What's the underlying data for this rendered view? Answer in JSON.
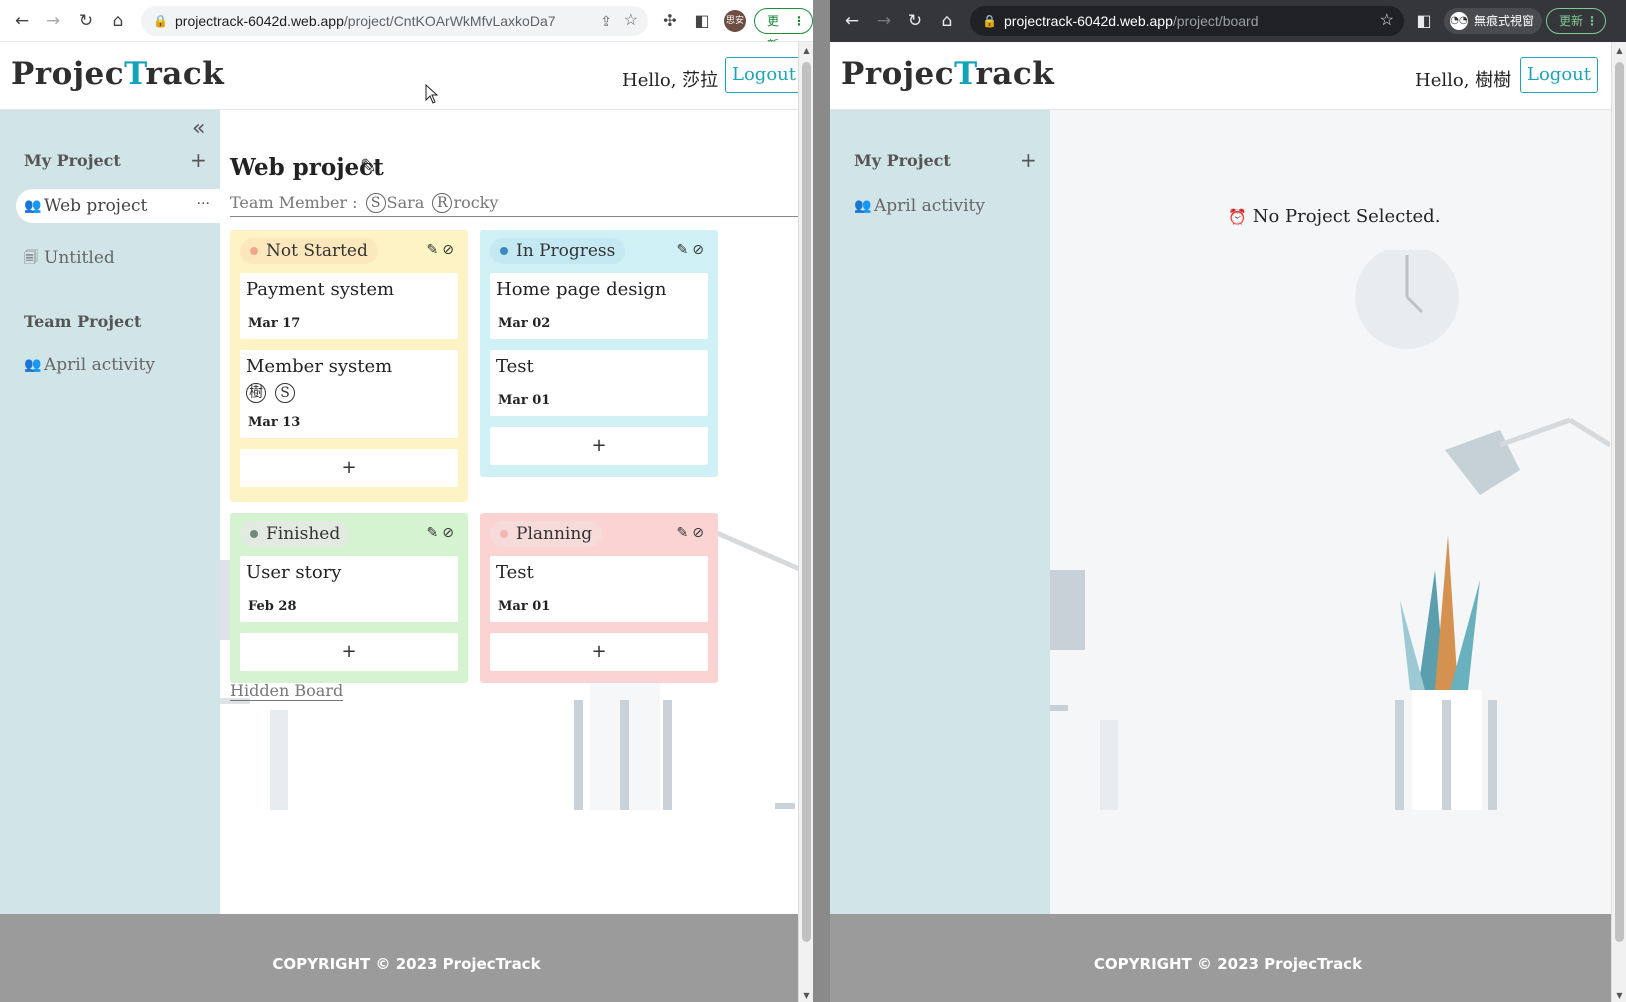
{
  "left": {
    "browser": {
      "url_host": "projectrack-6042d.web.app",
      "url_path": "/project/CntKOArWkMfvLaxkoDa7",
      "profile_label": "思安",
      "update_label": "更新"
    },
    "header": {
      "logo_pre": "Projec",
      "logo_accent": "T",
      "logo_post": "rack",
      "hello": "Hello, 莎拉",
      "logout": "Logout"
    },
    "sidebar": {
      "my_project_title": "My Project",
      "add": "+",
      "my_items": [
        {
          "label": "Web project",
          "more": "···"
        },
        {
          "label": "Untitled"
        }
      ],
      "team_project_title": "Team Project",
      "team_items": [
        {
          "label": "April activity"
        }
      ]
    },
    "project": {
      "title": "Web project",
      "team_label": "Team Member :",
      "members": [
        {
          "initial": "S",
          "name": "Sara"
        },
        {
          "initial": "R",
          "name": "rocky"
        }
      ]
    },
    "boards": [
      {
        "name": "Not Started",
        "color": "#fdf3c4",
        "header_color": "#fce8bc",
        "dot_color": "#f0a88a",
        "cards": [
          {
            "title": "Payment system",
            "date": "Mar 17"
          },
          {
            "title": "Member system",
            "avatars": [
              "樹",
              "S"
            ],
            "date": "Mar 13"
          }
        ],
        "add": "+"
      },
      {
        "name": "In Progress",
        "color": "#cff0f5",
        "header_color": "#c4e9f3",
        "dot_color": "#3b8bbf",
        "cards": [
          {
            "title": "Home page design",
            "date": "Mar 02"
          },
          {
            "title": "Test",
            "date": "Mar 01"
          }
        ],
        "add": "+"
      },
      {
        "name": "Finished",
        "color": "#d5f3d1",
        "header_color": "#e3eae1",
        "dot_color": "#6e8a78",
        "cards": [
          {
            "title": "User story",
            "date": "Feb 28"
          }
        ],
        "add": "+"
      },
      {
        "name": "Planning",
        "color": "#fbd3d3",
        "header_color": "#f7dada",
        "dot_color": "#f2b6b6",
        "cards": [
          {
            "title": "Test",
            "date": "Mar 01"
          }
        ],
        "add": "+"
      }
    ],
    "hidden_board": "Hidden Board",
    "footer": "COPYRIGHT © 2023 ProjecTrack"
  },
  "right": {
    "browser": {
      "url_host": "projectrack-6042d.web.app",
      "url_path": "/project/board",
      "incognito_label": "無痕式視窗",
      "update_label": "更新"
    },
    "header": {
      "logo_pre": "Projec",
      "logo_accent": "T",
      "logo_post": "rack",
      "hello": "Hello, 樹樹",
      "logout": "Logout"
    },
    "sidebar": {
      "my_project_title": "My Project",
      "add": "+",
      "my_items": [
        {
          "label": "April activity"
        }
      ]
    },
    "empty_message": "No Project Selected.",
    "footer": "COPYRIGHT © 2023 ProjecTrack"
  }
}
